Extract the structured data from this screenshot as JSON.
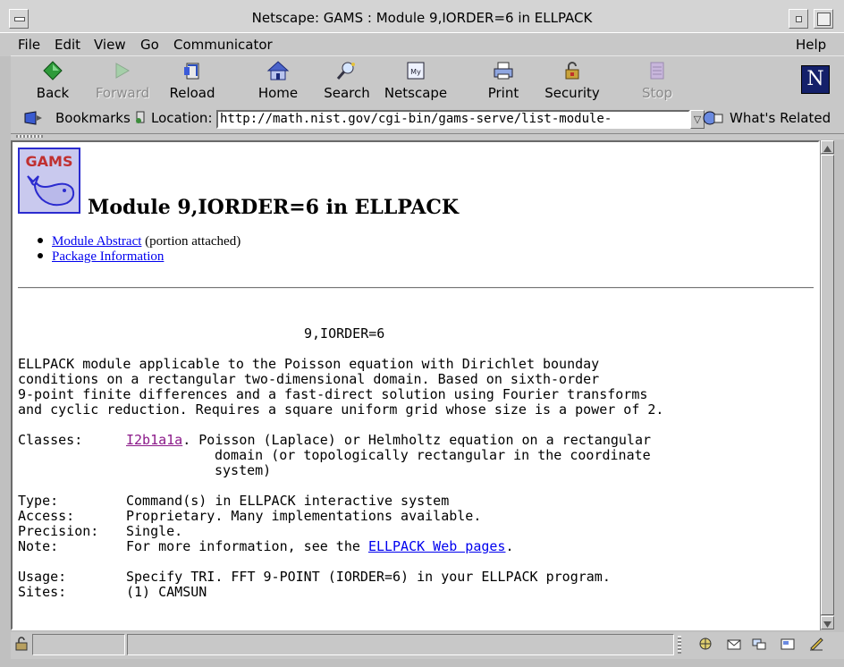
{
  "window": {
    "title": "Netscape: GAMS : Module 9,IORDER=6 in ELLPACK"
  },
  "menubar": {
    "items": [
      "File",
      "Edit",
      "View",
      "Go",
      "Communicator"
    ],
    "help": "Help"
  },
  "toolbar": {
    "buttons": [
      {
        "label": "Back",
        "icon": "back-arrow-icon",
        "enabled": true
      },
      {
        "label": "Forward",
        "icon": "forward-arrow-icon",
        "enabled": false
      },
      {
        "label": "Reload",
        "icon": "reload-icon",
        "enabled": true
      },
      {
        "label": "Home",
        "icon": "home-icon",
        "enabled": true
      },
      {
        "label": "Search",
        "icon": "search-icon",
        "enabled": true
      },
      {
        "label": "Netscape",
        "icon": "netscape-icon",
        "enabled": true
      },
      {
        "label": "Print",
        "icon": "printer-icon",
        "enabled": true
      },
      {
        "label": "Security",
        "icon": "lock-icon",
        "enabled": true
      },
      {
        "label": "Stop",
        "icon": "stop-icon",
        "enabled": false
      }
    ],
    "brand_letter": "N"
  },
  "locationbar": {
    "bookmarks_label": "Bookmarks",
    "location_label": "Location:",
    "url": "http://math.nist.gov/cgi-bin/gams-serve/list-module-",
    "whats_related": "What's Related"
  },
  "page": {
    "logo_text": "GAMS",
    "title": "Module 9,IORDER=6 in ELLPACK",
    "links": [
      {
        "text": "Module Abstract",
        "suffix": " (portion attached)"
      },
      {
        "text": "Package Information",
        "suffix": ""
      }
    ],
    "module_name": "9,IORDER=6",
    "description": [
      "ELLPACK module applicable to the Poisson equation with Dirichlet bounday",
      "conditions on a rectangular two-dimensional domain. Based on sixth-order",
      "9-point finite differences and a fast-direct solution using Fourier transforms",
      "and cyclic reduction. Requires a square uniform grid whose size is a power of 2."
    ],
    "classes": {
      "label": "Classes:",
      "link": "I2b1a1a",
      "lines": [
        ". Poisson (Laplace) or Helmholtz equation on a rectangular",
        "domain (or topologically rectangular in the coordinate",
        "system)"
      ]
    },
    "fields": [
      {
        "label": "Type:",
        "value": "Command(s) in ELLPACK interactive system"
      },
      {
        "label": "Access:",
        "value": "Proprietary. Many implementations available."
      },
      {
        "label": "Precision:",
        "value": "Single."
      }
    ],
    "note": {
      "label": "Note:",
      "prefix": "For more information, see the ",
      "link": "ELLPACK Web pages",
      "suffix": "."
    },
    "usage": {
      "label": "Usage:",
      "value": "Specify TRI. FFT 9-POINT (IORDER=6) in your ELLPACK program."
    },
    "sites": {
      "label": "Sites:",
      "value": "(1) CAMSUN"
    }
  },
  "colors": {
    "link": "#0000ee",
    "visited_link": "#8b1a89",
    "chrome": "#c8c8c8"
  }
}
